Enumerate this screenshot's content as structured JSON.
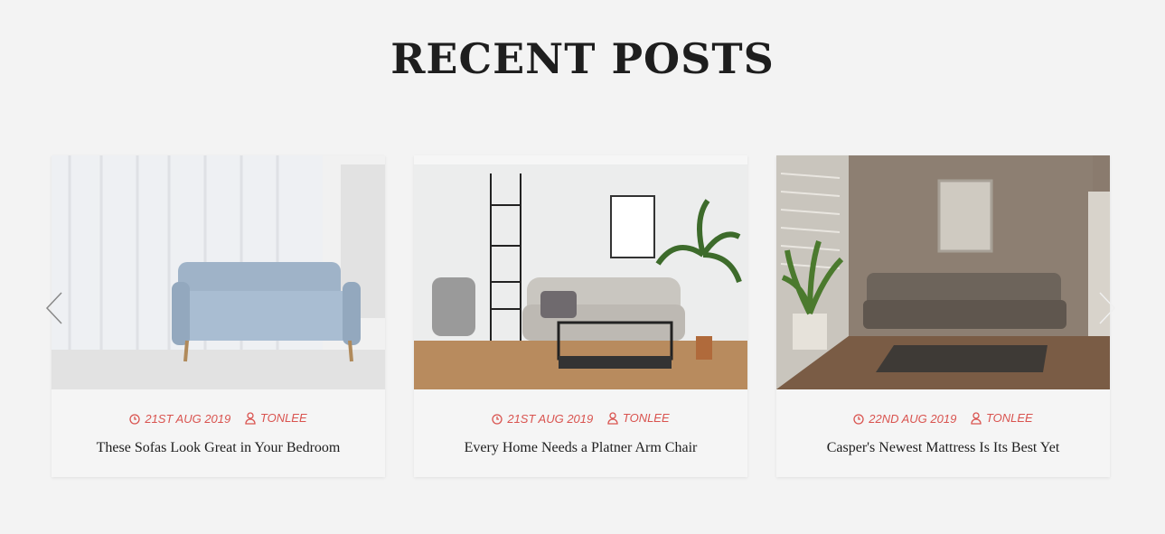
{
  "section": {
    "title": "RECENT POSTS"
  },
  "posts": [
    {
      "date": "21ST AUG 2019",
      "author": "TONLEE",
      "title": "These Sofas Look Great in Your Bedroom",
      "image": "blue-sofa-photo"
    },
    {
      "date": "21ST AUG 2019",
      "author": "TONLEE",
      "title": "Every Home Needs a Platner Arm Chair",
      "image": "grey-sofa-living-room-photo"
    },
    {
      "date": "22ND AUG 2019",
      "author": "TONLEE",
      "title": "Casper's Newest Mattress Is Its Best Yet",
      "image": "brown-room-sofa-photo"
    }
  ],
  "colors": {
    "accent": "#d9534f",
    "background": "#f3f3f3",
    "title": "#1e1e1e"
  },
  "icons": {
    "date": "clock-icon",
    "author": "user-icon",
    "prev": "chevron-left-icon",
    "next": "chevron-right-icon"
  }
}
